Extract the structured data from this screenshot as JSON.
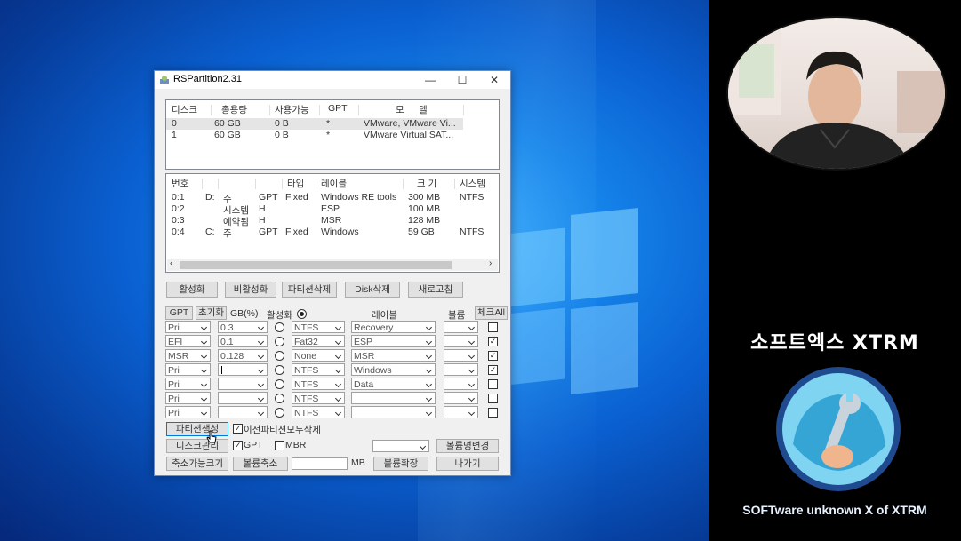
{
  "window": {
    "title": "RSPartition2.31",
    "controls": {
      "minimize": "—",
      "maximize": "☐",
      "close": "✕"
    }
  },
  "disk_list": {
    "headers": [
      "디스크",
      "총용량",
      "사용가능",
      "GPT",
      "모",
      "델"
    ],
    "rows": [
      {
        "disk": "0",
        "total": "60 GB",
        "free": "0 B",
        "gpt": "*",
        "model": "VMware, VMware Vi..."
      },
      {
        "disk": "1",
        "total": "60 GB",
        "free": "0 B",
        "gpt": "*",
        "model": "VMware Virtual SAT..."
      }
    ]
  },
  "partition_list": {
    "headers": [
      "번호",
      "",
      "",
      "",
      "타입",
      "레이블",
      "크 기",
      "시스템"
    ],
    "rows": [
      {
        "num": "0:1",
        "drive": "D:",
        "kind": "주",
        "style": "GPT",
        "type": "Fixed",
        "label": "Windows RE tools",
        "size": "300 MB",
        "fs": "NTFS"
      },
      {
        "num": "0:2",
        "drive": "",
        "kind": "시스템",
        "style": "H",
        "type": "",
        "label": "ESP",
        "size": "100 MB",
        "fs": ""
      },
      {
        "num": "0:3",
        "drive": "",
        "kind": "예약됨",
        "style": "H",
        "type": "",
        "label": "MSR",
        "size": "128 MB",
        "fs": ""
      },
      {
        "num": "0:4",
        "drive": "C:",
        "kind": "주",
        "style": "GPT",
        "type": "Fixed",
        "label": "Windows",
        "size": "59 GB",
        "fs": "NTFS"
      }
    ],
    "scroll_left": "‹",
    "scroll_right": "›"
  },
  "actions": {
    "activate": "활성화",
    "deactivate": "비활성화",
    "delete_partition": "파티션삭제",
    "delete_disk": "Disk삭제",
    "refresh": "새로고침"
  },
  "create_grid": {
    "gpt_button": "GPT",
    "init_button": "초기화",
    "size_label": "GB(%)",
    "active_label": "활성화",
    "label_header": "레이블",
    "volume_header": "볼륨",
    "check_all_button": "체크All",
    "rows": [
      {
        "type": "Pri",
        "size": "0.3",
        "active": false,
        "fs": "NTFS",
        "label": "Recovery",
        "volume": "",
        "checked": false
      },
      {
        "type": "EFI",
        "size": "0.1",
        "active": false,
        "fs": "Fat32",
        "label": "ESP",
        "volume": "",
        "checked": true
      },
      {
        "type": "MSR",
        "size": "0.128",
        "active": false,
        "fs": "None",
        "label": "MSR",
        "volume": "",
        "checked": true
      },
      {
        "type": "Pri",
        "size": "",
        "active": false,
        "fs": "NTFS",
        "label": "Windows",
        "volume": "",
        "checked": true
      },
      {
        "type": "Pri",
        "size": "",
        "active": false,
        "fs": "NTFS",
        "label": "Data",
        "volume": "",
        "checked": false
      },
      {
        "type": "Pri",
        "size": "",
        "active": false,
        "fs": "NTFS",
        "label": "",
        "volume": "",
        "checked": false
      },
      {
        "type": "Pri",
        "size": "",
        "active": false,
        "fs": "NTFS",
        "label": "",
        "volume": "",
        "checked": false
      }
    ]
  },
  "bottom": {
    "create_partition": "파티션생성",
    "delete_prev_label": "이전파티션모두삭제",
    "delete_prev_checked": true,
    "disk_manage": "디스크관리",
    "gpt_label": "GPT",
    "gpt_checked": true,
    "mbr_label": "MBR",
    "mbr_checked": false,
    "rename_volume": "볼륨명변경",
    "shrinkable": "축소가능크기",
    "shrink_volume": "볼륨축소",
    "mb_label": "MB",
    "mb_value": "",
    "extend_volume": "볼륨확장",
    "exit": "나가기"
  },
  "sidebar": {
    "brand_title": "소프트엑스 XTRM",
    "brand_subtitle": "SOFTware unknown X of XTRM"
  },
  "colors": {
    "accent": "#0078d7",
    "desktop": "#0a5fd0"
  }
}
